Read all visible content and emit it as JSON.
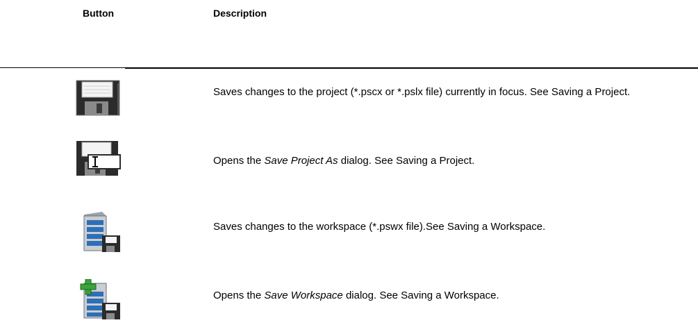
{
  "table": {
    "headers": {
      "button": "Button",
      "description": "Description"
    },
    "rows": [
      {
        "icon": "save-project-icon",
        "description_parts": {
          "before": "Saves changes to the project (*.pscx or *.pslx file) currently in focus. See Saving a Project.",
          "italic": "",
          "after": ""
        }
      },
      {
        "icon": "save-project-as-icon",
        "description_parts": {
          "before": "Opens the ",
          "italic": "Save Project As",
          "after": " dialog. See Saving a Project."
        }
      },
      {
        "icon": "save-workspace-icon",
        "description_parts": {
          "before": "Saves changes to the workspace (*.pswx file).See Saving a Workspace.",
          "italic": "",
          "after": ""
        }
      },
      {
        "icon": "save-workspace-as-icon",
        "description_parts": {
          "before": "Opens the ",
          "italic": "Save Workspace",
          "after": " dialog. See Saving a Workspace."
        }
      }
    ]
  },
  "colors": {
    "floppy_dark": "#3a3a3a",
    "floppy_label": "#e8e8e8",
    "server_blue": "#2f6fb5",
    "server_gray": "#bfc4c9",
    "plus_green": "#3aa33a"
  }
}
